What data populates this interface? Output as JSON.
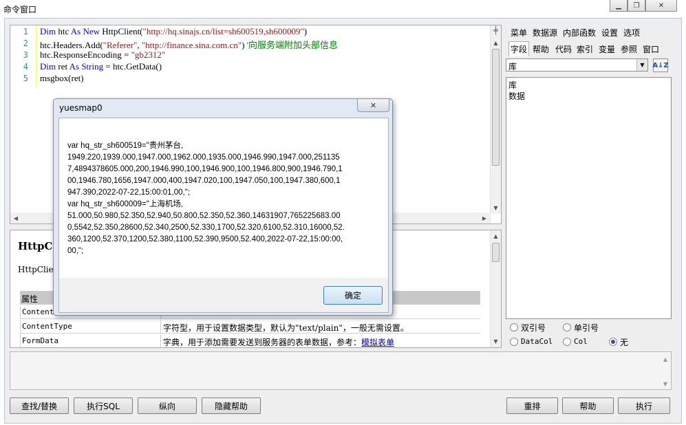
{
  "window": {
    "title": "命令窗口"
  },
  "editor": {
    "lines": [
      {
        "no": "1",
        "kw1": "Dim",
        "a": " htc ",
        "kw2": "As New",
        "b": " HttpClient(",
        "s1": "\"http://hq.sinajs.cn/list=sh600519,sh600009\"",
        "c": ")"
      },
      {
        "no": "2",
        "a": "htc.Headers.Add(",
        "s1": "\"Referer\"",
        "b": ", ",
        "s2": "\"http://finance.sina.com.cn\"",
        "c": ") ",
        "cm": "'向服务端附加头部信息"
      },
      {
        "no": "3",
        "a": "htc.ResponseEncoding = ",
        "s1": "\"gb2312\""
      },
      {
        "no": "4",
        "kw1": "Dim",
        "a": " ret ",
        "kw2": "As String",
        "b": " = htc.GetData()"
      },
      {
        "no": "5",
        "a": "msgbox(ret)"
      }
    ]
  },
  "right_panel": {
    "menu_row1": [
      "菜单",
      "数据源",
      "内部函数",
      "设置",
      "选项"
    ],
    "menu_row2": [
      "字段",
      "帮助",
      "代码",
      "索引",
      "变量",
      "参照",
      "窗口"
    ],
    "combo_value": "库",
    "list_items": [
      "库",
      "数据"
    ],
    "radios": [
      {
        "label": "双引号",
        "checked": false
      },
      {
        "label": "单引号",
        "checked": false
      },
      {
        "label": "DataCol",
        "checked": false
      },
      {
        "label": "Col",
        "checked": false
      },
      {
        "label": "无",
        "checked": true
      }
    ]
  },
  "help": {
    "title": "HttpCl",
    "subtitle": "HttpClie",
    "header": "属性",
    "rows": [
      {
        "name": "Content",
        "desc": ""
      },
      {
        "name": "ContentType",
        "desc": "字符型，用于设置数据类型，默认为\"text/plain\"，一般无需设置。"
      },
      {
        "name": "FormData",
        "desc": "字典，用于添加需要发送到服务器的表单数据，参考：",
        "link": "模拟表单"
      }
    ]
  },
  "dialog": {
    "title": "yuesmap0",
    "text": "var hq_str_sh600519=\"贵州茅台,\n1949.220,1939.000,1947.000,1962.000,1935.000,1946.990,1947.000,251135\n7,4894378605.000,200,1946.990,100,1946.900,100,1946.800,900,1946.790,1\n00,1946.780,1656,1947.000,400,1947.020,100,1947.050,100,1947.380,600,1\n947.390,2022-07-22,15:00:01,00,\";\nvar hq_str_sh600009=\"上海机场,\n51.000,50.980,52.350,52.940,50.800,52.350,52.360,14631907,765225683.00\n0,5542,52.350,28600,52.340,2500,52.330,1700,52.320,6100,52.310,16000,52.\n360,1200,52.370,1200,52.380,1100,52.390,9500,52.400,2022-07-22,15:00:00,\n00,\";",
    "ok": "确定"
  },
  "buttons": {
    "find_replace": "查找/替换",
    "exec_sql": "执行SQL",
    "vertical": "纵向",
    "hide_help": "隐藏帮助",
    "rearrange": "重排",
    "help": "帮助",
    "execute": "执行"
  }
}
